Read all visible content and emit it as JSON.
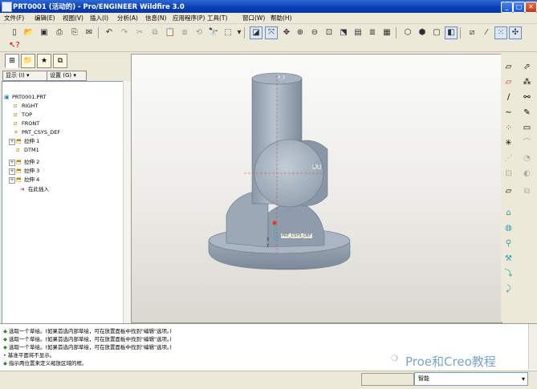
{
  "window": {
    "title": "PRT0001 (活动的) - Pro/ENGINEER Wildfire 3.0"
  },
  "menu": [
    "文件(F)",
    "编辑(E)",
    "视图(V)",
    "插入(I)",
    "分析(A)",
    "信息(N)",
    "应用程序(P)",
    "工具(T)",
    "窗口(W)",
    "帮助(H)"
  ],
  "navigator": {
    "show_label": "显示 (I) ▾",
    "settings_label": "设置 (G) ▾"
  },
  "tree": [
    {
      "label": "PRT0001.PRT",
      "icon": "part-icon",
      "level": 0
    },
    {
      "label": "RIGHT",
      "icon": "datum-plane-icon",
      "level": 1
    },
    {
      "label": "TOP",
      "icon": "datum-plane-icon",
      "level": 1
    },
    {
      "label": "FRONT",
      "icon": "datum-plane-icon",
      "level": 1
    },
    {
      "label": "PRT_CSYS_DEF",
      "icon": "csys-icon",
      "level": 1
    },
    {
      "label": "拉伸 1",
      "icon": "extrude-icon",
      "level": 1,
      "expandable": true
    },
    {
      "label": "DTM1",
      "icon": "datum-plane-icon",
      "level": 1
    },
    {
      "label": "拉伸 2",
      "icon": "extrude-icon",
      "level": 1,
      "expandable": true
    },
    {
      "label": "拉伸 3",
      "icon": "extrude-icon",
      "level": 1,
      "expandable": true
    },
    {
      "label": "拉伸 4",
      "icon": "extrude-icon",
      "level": 1,
      "expandable": true
    },
    {
      "label": "在此插入",
      "icon": "insert-here-icon",
      "level": 1
    }
  ],
  "model_labels": {
    "axis_top": "A_1",
    "axis_mid": "A_1",
    "csys": "PRT_CSYS_DEF",
    "x": "X",
    "y": "Y"
  },
  "messages": [
    {
      "type": "prompt",
      "text": "选取一个草绘。(如果首选内部草绘，可在放置面板中找到\"编辑\"选项。)"
    },
    {
      "type": "prompt",
      "text": "选取一个草绘。(如果首选内部草绘，可在放置面板中找到\"编辑\"选项。)"
    },
    {
      "type": "prompt",
      "text": "选取一个草绘。(如果首选内部草绘，可在放置面板中找到\"编辑\"选项。)"
    },
    {
      "type": "info",
      "text": "基准平面将不显示。"
    },
    {
      "type": "prompt",
      "text": "指示两位置来定义缩放区域的框。"
    }
  ],
  "watermark": "Proe和Creo教程",
  "status": {
    "filter": "智能"
  },
  "colors": {
    "title_bar": "#0a3fb5",
    "model_gray": "#9aa6b3",
    "viewport_bg": "#f2f1ee",
    "prompt_arrow": "#2e8b2e"
  }
}
